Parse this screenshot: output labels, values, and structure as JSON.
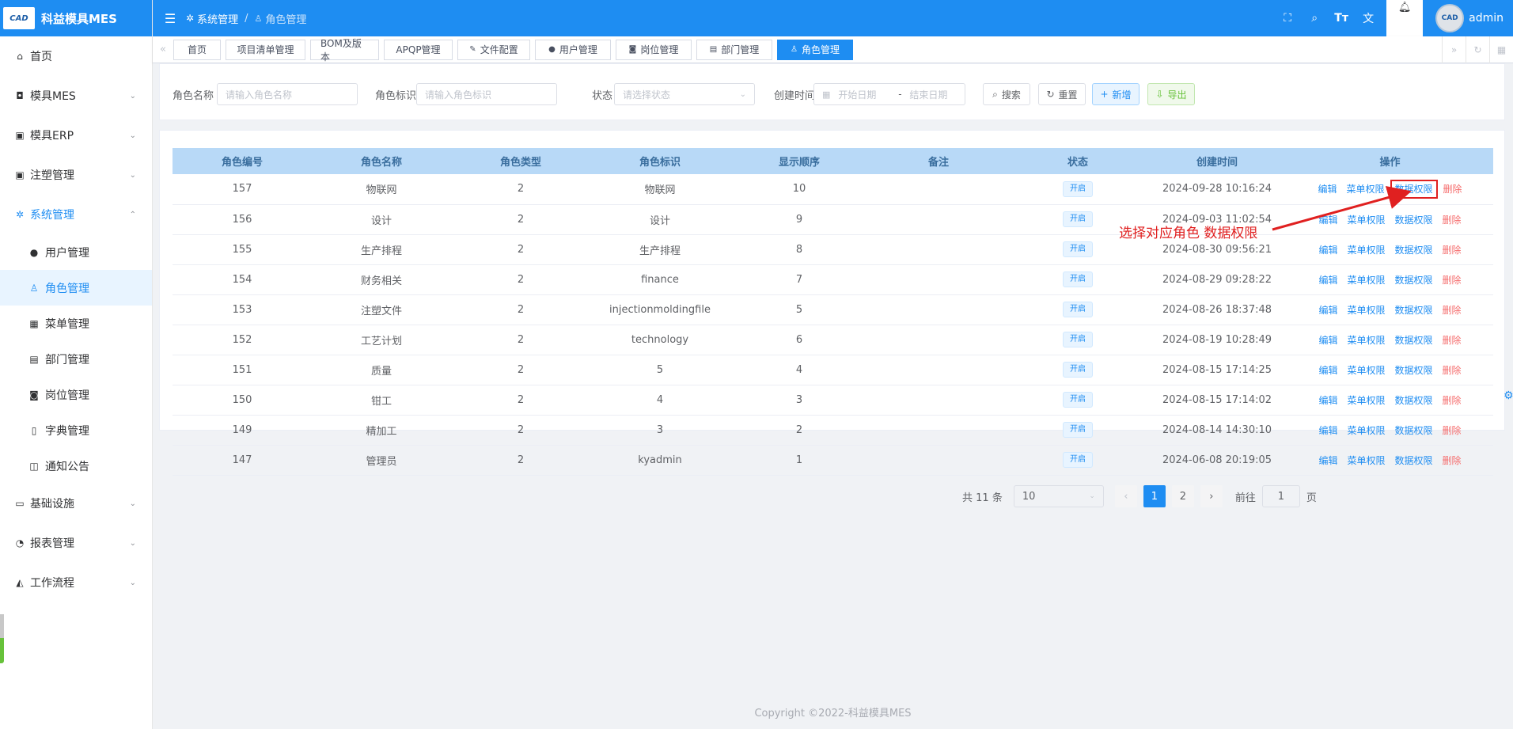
{
  "app": {
    "name": "科益模具MES",
    "logo_text": "CAD"
  },
  "sidebar": {
    "items": [
      {
        "label": "首页",
        "icon": "home-icon"
      },
      {
        "label": "模具MES",
        "icon": "camera-icon"
      },
      {
        "label": "模具ERP",
        "icon": "briefcase-icon"
      },
      {
        "label": "注塑管理",
        "icon": "briefcase-icon"
      },
      {
        "label": "系统管理",
        "icon": "gear-icon"
      },
      {
        "label": "基础设施",
        "icon": "monitor-icon"
      },
      {
        "label": "报表管理",
        "icon": "chart-icon"
      },
      {
        "label": "工作流程",
        "icon": "flow-icon"
      }
    ],
    "sub_items": [
      {
        "label": "用户管理",
        "icon": "user-icon"
      },
      {
        "label": "角色管理",
        "icon": "peoples-icon"
      },
      {
        "label": "菜单管理",
        "icon": "grid-icon"
      },
      {
        "label": "部门管理",
        "icon": "idcard-icon"
      },
      {
        "label": "岗位管理",
        "icon": "badge-icon"
      },
      {
        "label": "字典管理",
        "icon": "book-icon"
      },
      {
        "label": "通知公告",
        "icon": "message-icon"
      }
    ]
  },
  "header": {
    "breadcrumb": {
      "parent": "系统管理",
      "current": "角色管理"
    },
    "user": "admin"
  },
  "tags": [
    {
      "label": "首页"
    },
    {
      "label": "项目清单管理"
    },
    {
      "label": "BOM及版本"
    },
    {
      "label": "APQP管理"
    },
    {
      "label": "文件配置"
    },
    {
      "label": "用户管理"
    },
    {
      "label": "岗位管理"
    },
    {
      "label": "部门管理"
    },
    {
      "label": "角色管理"
    }
  ],
  "search": {
    "role_name_label": "角色名称",
    "role_name_placeholder": "请输入角色名称",
    "role_key_label": "角色标识",
    "role_key_placeholder": "请输入角色标识",
    "status_label": "状态",
    "status_placeholder": "请选择状态",
    "created_label": "创建时间",
    "start_placeholder": "开始日期",
    "range_sep": "-",
    "end_placeholder": "结束日期",
    "search_btn": "搜索",
    "reset_btn": "重置",
    "add_btn": "新增",
    "export_btn": "导出"
  },
  "table": {
    "headers": [
      "角色编号",
      "角色名称",
      "角色类型",
      "角色标识",
      "显示顺序",
      "备注",
      "状态",
      "创建时间",
      "操作"
    ],
    "rows": [
      {
        "id": "157",
        "name": "物联网",
        "type": "2",
        "key": "物联网",
        "order": "10",
        "remark": "",
        "status": "开启",
        "created": "2024-09-28 10:16:24"
      },
      {
        "id": "156",
        "name": "设计",
        "type": "2",
        "key": "设计",
        "order": "9",
        "remark": "",
        "status": "开启",
        "created": "2024-09-03 11:02:54"
      },
      {
        "id": "155",
        "name": "生产排程",
        "type": "2",
        "key": "生产排程",
        "order": "8",
        "remark": "",
        "status": "开启",
        "created": "2024-08-30 09:56:21"
      },
      {
        "id": "154",
        "name": "财务相关",
        "type": "2",
        "key": "finance",
        "order": "7",
        "remark": "",
        "status": "开启",
        "created": "2024-08-29 09:28:22"
      },
      {
        "id": "153",
        "name": "注塑文件",
        "type": "2",
        "key": "injectionmoldingfile",
        "order": "5",
        "remark": "",
        "status": "开启",
        "created": "2024-08-26 18:37:48"
      },
      {
        "id": "152",
        "name": "工艺计划",
        "type": "2",
        "key": "technology",
        "order": "6",
        "remark": "",
        "status": "开启",
        "created": "2024-08-19 10:28:49"
      },
      {
        "id": "151",
        "name": "质量",
        "type": "2",
        "key": "5",
        "order": "4",
        "remark": "",
        "status": "开启",
        "created": "2024-08-15 17:14:25"
      },
      {
        "id": "150",
        "name": "钳工",
        "type": "2",
        "key": "4",
        "order": "3",
        "remark": "",
        "status": "开启",
        "created": "2024-08-15 17:14:02"
      },
      {
        "id": "149",
        "name": "精加工",
        "type": "2",
        "key": "3",
        "order": "2",
        "remark": "",
        "status": "开启",
        "created": "2024-08-14 14:30:10"
      },
      {
        "id": "147",
        "name": "管理员",
        "type": "2",
        "key": "kyadmin",
        "order": "1",
        "remark": "",
        "status": "开启",
        "created": "2024-06-08 20:19:05"
      }
    ],
    "actions": {
      "edit": "编辑",
      "menu_perm": "菜单权限",
      "data_perm": "数据权限",
      "delete": "删除"
    }
  },
  "pagination": {
    "total_prefix": "共",
    "total": "11",
    "total_suffix": "条",
    "page_size": "10",
    "pages": [
      "1",
      "2"
    ],
    "current_page": "1",
    "goto_prefix": "前往",
    "goto_value": "1",
    "goto_suffix": "页"
  },
  "annotation": "选择对应角色 数据权限",
  "footer": {
    "copyright": "Copyright ©2022-科益模具MES"
  },
  "colors": {
    "primary": "#1e8df2",
    "danger": "#f56c6c",
    "success": "#67c23a",
    "annotation": "#e02020"
  }
}
